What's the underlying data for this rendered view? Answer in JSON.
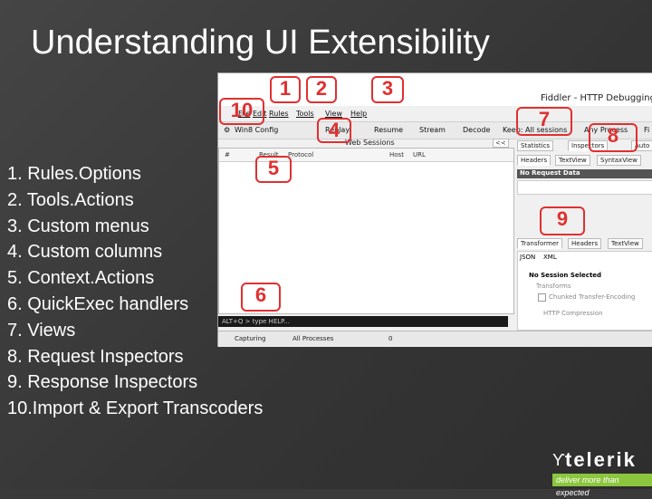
{
  "slide": {
    "title": "Understanding UI Extensibility",
    "items": [
      "1. Rules.Options",
      "2. Tools.Actions",
      "3. Custom menus",
      "4. Custom columns",
      "5. Context.Actions",
      "6. QuickExec handlers",
      "7. Views",
      "8. Request Inspectors",
      "9. Response Inspectors",
      "10.Import & Export Transcoders"
    ]
  },
  "screenshot": {
    "app_title": "Fiddler - HTTP Debugging",
    "menu": [
      "File",
      "Edit",
      "Rules",
      "Tools",
      "View",
      "Help"
    ],
    "toolbar": [
      "Win8 Config",
      "Replay",
      "Resume",
      "Stream",
      "Decode",
      "Keep: All sessions",
      "Any Process",
      "Fi"
    ],
    "columns": [
      "#",
      "Result",
      "Protocol",
      "Host",
      "URL"
    ],
    "web_sessions_label": "Web Sessions",
    "collapse": "<<",
    "top_tabs": [
      "Statistics",
      "Inspectors",
      "Auto"
    ],
    "request_tabs": [
      "Headers",
      "TextView",
      "SyntaxView"
    ],
    "no_request": "No Request Data",
    "response_tabs": [
      "Transformer",
      "Headers",
      "TextView"
    ],
    "response_subtabs": [
      "JSON",
      "XML"
    ],
    "no_session": "No Session Selected",
    "transforms_label": "Transforms",
    "chunked": "Chunked Transfer-Encoding",
    "compression": "HTTP Compression",
    "quickexec": "ALT+Q > type HELP...",
    "status_capturing": "Capturing",
    "status_processes": "All Processes",
    "status_count": "0"
  },
  "badges": [
    "1",
    "2",
    "3",
    "4",
    "5",
    "6",
    "7",
    "8",
    "9",
    "10"
  ],
  "logo": {
    "word": "telerik",
    "tagline": "deliver more than expected"
  },
  "colors": {
    "background": "#3a3a3a",
    "badge": "#e03030",
    "logo_green": "#8cc63f"
  }
}
